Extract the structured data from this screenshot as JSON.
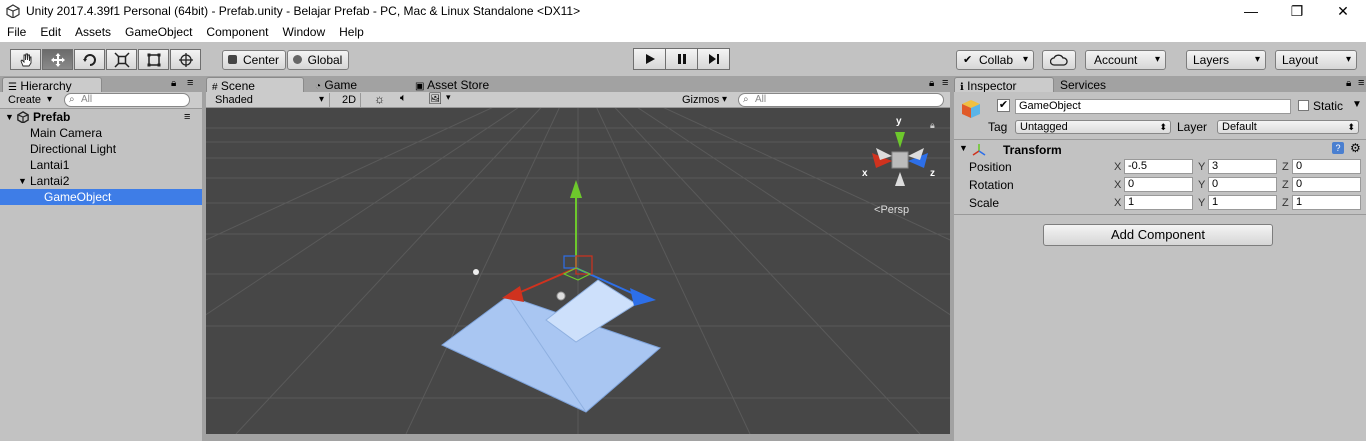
{
  "window": {
    "title": "Unity 2017.4.39f1 Personal (64bit) - Prefab.unity - Belajar Prefab - PC, Mac & Linux Standalone <DX11>",
    "minimize": "—",
    "restore": "❐",
    "close": "✕"
  },
  "menu": [
    "File",
    "Edit",
    "Assets",
    "GameObject",
    "Component",
    "Window",
    "Help"
  ],
  "toolbar": {
    "pivot": "Center",
    "space": "Global",
    "collab": "Collab",
    "account": "Account",
    "layers": "Layers",
    "layout": "Layout"
  },
  "hierarchy": {
    "tab": "Hierarchy",
    "create": "Create",
    "search_placeholder": "All",
    "scene": "Prefab",
    "items": [
      {
        "label": "Main Camera"
      },
      {
        "label": "Directional Light"
      },
      {
        "label": "Lantai1"
      },
      {
        "label": "Lantai2"
      },
      {
        "label": "GameObject"
      }
    ]
  },
  "scene": {
    "tabs": [
      "Scene",
      "Game",
      "Asset Store"
    ],
    "shading": "Shaded",
    "mode2d": "2D",
    "gizmos": "Gizmos",
    "search_placeholder": "All",
    "projection": "Persp",
    "gizmo_labels": {
      "x": "x",
      "y": "y",
      "z": "z"
    }
  },
  "inspector": {
    "tabs": [
      "Inspector",
      "Services"
    ],
    "object_name": "GameObject",
    "active": true,
    "static_label": "Static",
    "tag_label": "Tag",
    "tag_value": "Untagged",
    "layer_label": "Layer",
    "layer_value": "Default",
    "component": "Transform",
    "rows": [
      {
        "label": "Position",
        "x": "-0.5",
        "y": "3",
        "z": "0"
      },
      {
        "label": "Rotation",
        "x": "0",
        "y": "0",
        "z": "0"
      },
      {
        "label": "Scale",
        "x": "1",
        "y": "1",
        "z": "1"
      }
    ],
    "axis": {
      "x": "X",
      "y": "Y",
      "z": "Z"
    },
    "add_component": "Add Component"
  },
  "colors": {
    "selection": "#3e7de7",
    "scene_bg": "#474747",
    "panel_bg": "#c2c2c2",
    "axis_x": "#d0321e",
    "axis_y": "#6dc82c",
    "axis_z": "#2d6fe8"
  }
}
